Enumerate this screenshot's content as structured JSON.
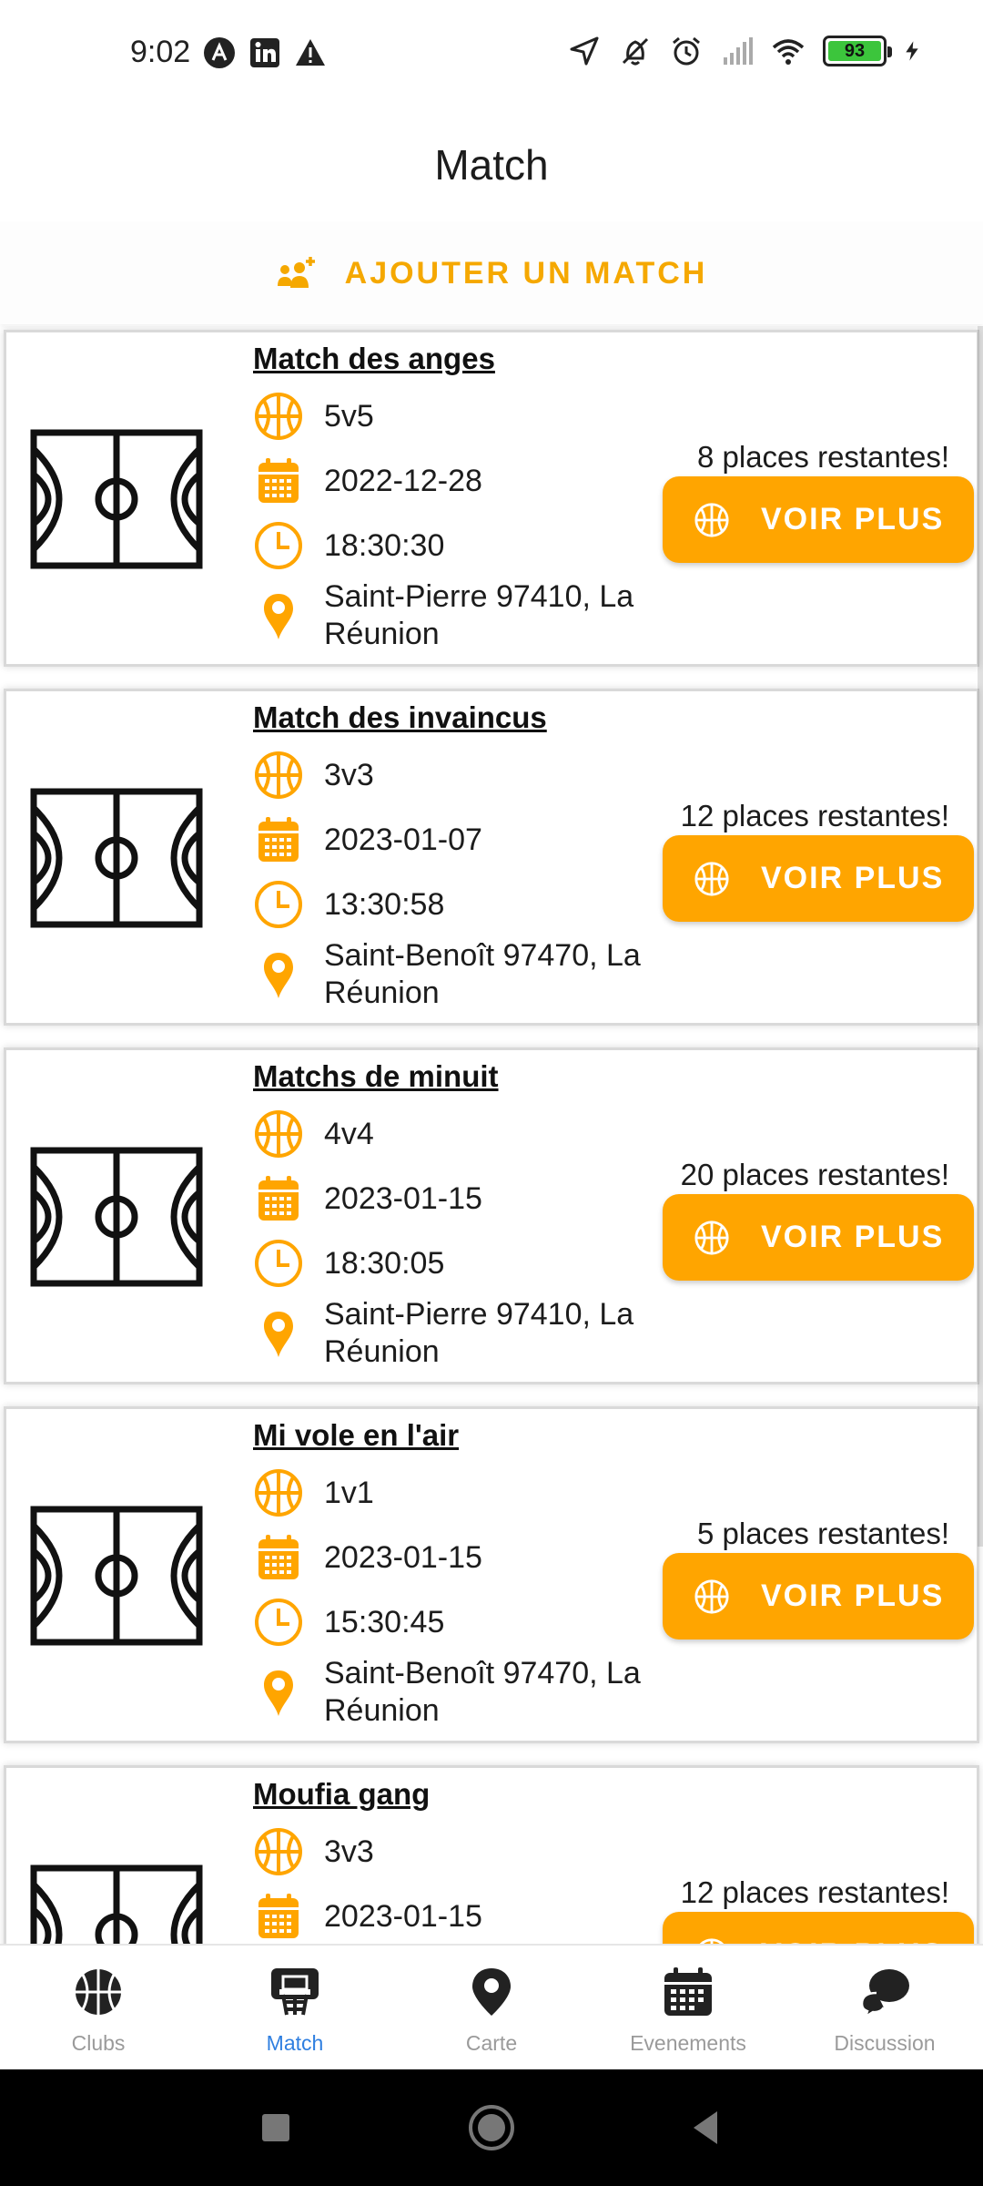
{
  "status_bar": {
    "time": "9:02",
    "battery": "93",
    "icons": [
      "auto-icon",
      "linkedin-icon",
      "warning-icon",
      "location-arrow-icon",
      "vibrate-off-icon",
      "alarm-icon",
      "signal-icon",
      "wifi-icon",
      "battery-icon",
      "charging-icon"
    ]
  },
  "header": {
    "title": "Match"
  },
  "add_match": {
    "label": "AJOUTER UN MATCH",
    "icon": "add-team-icon"
  },
  "colors": {
    "accent": "#FFA500",
    "active_nav": "#2F7FE0",
    "inactive_nav": "#9A9A9A"
  },
  "matches": [
    {
      "name": "Match des anges",
      "format": "5v5",
      "date": "2022-12-28",
      "time": "18:30:30",
      "location": "Saint-Pierre 97410, La Réunion",
      "places": "8 places restantes!",
      "button": "VOIR PLUS"
    },
    {
      "name": "Match des invaincus",
      "format": "3v3",
      "date": "2023-01-07",
      "time": "13:30:58",
      "location": "Saint-Benoît 97470, La Réunion",
      "places": "12 places restantes!",
      "button": "VOIR PLUS"
    },
    {
      "name": "Matchs de minuit",
      "format": "4v4",
      "date": "2023-01-15",
      "time": "18:30:05",
      "location": "Saint-Pierre 97410, La Réunion",
      "places": "20 places restantes!",
      "button": "VOIR PLUS"
    },
    {
      "name": "Mi vole en l'air",
      "format": "1v1",
      "date": "2023-01-15",
      "time": "15:30:45",
      "location": "Saint-Benoît 97470, La Réunion",
      "places": "5 places restantes!",
      "button": "VOIR PLUS"
    },
    {
      "name": "Moufia gang",
      "format": "3v3",
      "date": "2023-01-15",
      "time": "",
      "location": "",
      "places": "12 places restantes!",
      "button": "VOIR PLUS"
    }
  ],
  "bottom_nav": [
    {
      "label": "Clubs",
      "icon": "basketball-icon",
      "active": false
    },
    {
      "label": "Match",
      "icon": "hoop-icon",
      "active": true
    },
    {
      "label": "Carte",
      "icon": "map-pin-icon",
      "active": false
    },
    {
      "label": "Evenements",
      "icon": "calendar-icon",
      "active": false
    },
    {
      "label": "Discussion",
      "icon": "chat-icon",
      "active": false
    }
  ],
  "system_nav": [
    "recents-button",
    "home-button",
    "back-button"
  ]
}
